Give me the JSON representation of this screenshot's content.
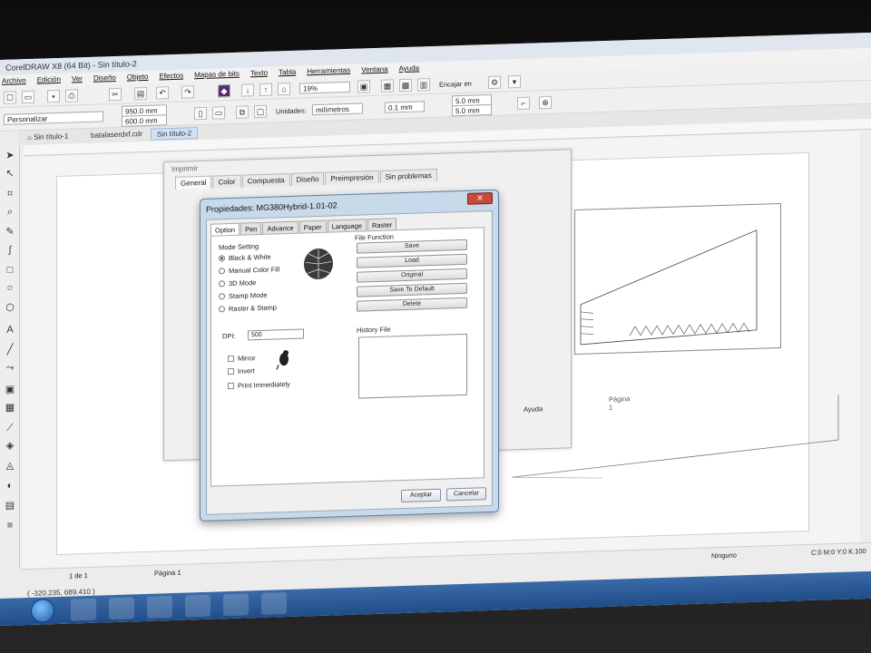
{
  "window": {
    "title": "CorelDRAW X8 (64 Bit) - Sin título-2"
  },
  "menu": [
    "Archivo",
    "Edición",
    "Ver",
    "Diseño",
    "Objeto",
    "Efectos",
    "Mapas de bits",
    "Texto",
    "Tabla",
    "Herramientas",
    "Ventana",
    "Ayuda"
  ],
  "toolbar": {
    "zoom": "19%",
    "snap": "Encajar en",
    "preset": "Personalizar",
    "width": "950.0 mm",
    "height": "600.0 mm",
    "units_label": "Unidades:",
    "units": "milímetros",
    "nudge": "0.1 mm",
    "dup_x": "5.0 mm",
    "dup_y": "5.0 mm"
  },
  "tabs": [
    "Sin título-1",
    "batalaserdxf.cdr",
    "Sin título-2"
  ],
  "print_dialog": {
    "title": "Imprimir",
    "tabs": [
      "General",
      "Color",
      "Compuesta",
      "Diseño",
      "Preimpresión",
      "Sin problemas"
    ],
    "apply": "Ayuda",
    "page_label": "Página 1"
  },
  "properties_dialog": {
    "title": "Propiedades: MG380Hybrid-1.01-02",
    "tabs": [
      "Option",
      "Pen",
      "Advance",
      "Paper",
      "Language",
      "Raster"
    ],
    "mode_title": "Mode Setting",
    "modes": [
      "Black & White",
      "Manual Color Fill",
      "3D Mode",
      "Stamp Mode",
      "Raster & Stamp"
    ],
    "dpi_label": "DPI:",
    "dpi_value": "500",
    "options": [
      "Mirror",
      "Invert",
      "Print Immediately"
    ],
    "file_function_title": "File Function",
    "file_buttons": [
      "Save",
      "Load",
      "Original",
      "Save To Default",
      "Delete"
    ],
    "history_title": "History File",
    "accept": "Aceptar",
    "cancel": "Cancelar"
  },
  "status": {
    "page_count": "1 de 1",
    "page_tab": "Página 1",
    "coords": "( -320.235, 689.410 )",
    "fill_status": "Ninguno",
    "color_info": "C:0 M:0 Y:0 K:100"
  }
}
